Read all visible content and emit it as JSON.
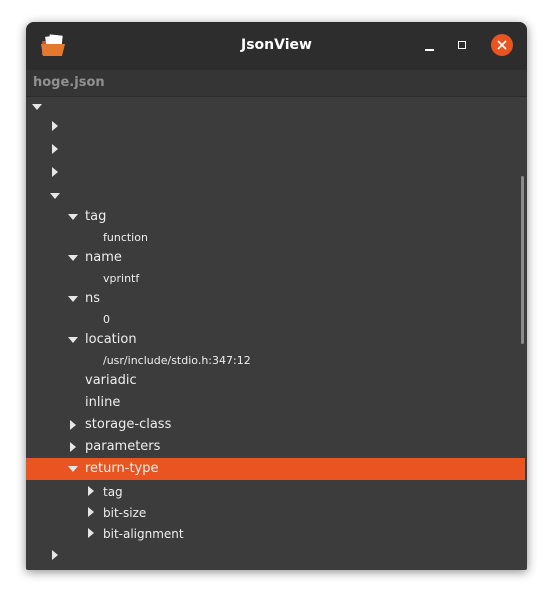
{
  "window": {
    "title": "JsonView"
  },
  "header": {
    "filename": "hoge.json"
  },
  "tree": {
    "l1": "",
    "l2": "",
    "l3": "",
    "l4": "",
    "tag": "tag",
    "tag_value": "function",
    "name": "name",
    "name_value": "vprintf",
    "ns": "ns",
    "ns_value": "0",
    "location": "location",
    "location_value": "/usr/include/stdio.h:347:12",
    "variadic": "variadic",
    "inline": "inline",
    "storage_class": "storage-class",
    "parameters": "parameters",
    "return_type": "return-type",
    "rt_tag": "tag",
    "rt_bit_size": "bit-size",
    "rt_bit_alignment": "bit-alignment",
    "l5": ""
  },
  "colors": {
    "accent": "#e95420",
    "titlebar": "#2d2d2d",
    "background": "#3c3c3c"
  }
}
